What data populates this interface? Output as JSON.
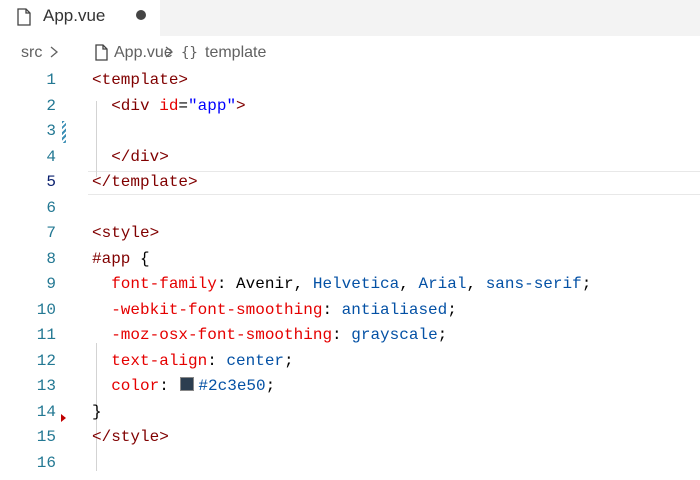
{
  "tab": {
    "filename": "App.vue",
    "dirty": true
  },
  "breadcrumb": {
    "folder": "src",
    "file": "App.vue",
    "symbol_glyph": "{}",
    "symbol": "template"
  },
  "editor": {
    "active_line": 5,
    "lines": [
      {
        "num": "1",
        "tokens": [
          [
            "t-tag",
            "<template>"
          ]
        ]
      },
      {
        "num": "2",
        "tokens": [
          [
            "t-pun",
            "  "
          ],
          [
            "t-tag",
            "<div"
          ],
          [
            "t-pun",
            " "
          ],
          [
            "t-attr",
            "id"
          ],
          [
            "t-pun",
            "="
          ],
          [
            "t-str",
            "\"app\""
          ],
          [
            "t-tag",
            ">"
          ]
        ]
      },
      {
        "num": "3",
        "tokens": []
      },
      {
        "num": "4",
        "tokens": [
          [
            "t-pun",
            "  "
          ],
          [
            "t-tag",
            "</div>"
          ]
        ]
      },
      {
        "num": "5",
        "tokens": [
          [
            "t-tag",
            "</template>"
          ]
        ]
      },
      {
        "num": "6",
        "tokens": []
      },
      {
        "num": "7",
        "tokens": [
          [
            "t-tag",
            "<style>"
          ]
        ]
      },
      {
        "num": "8",
        "tokens": [
          [
            "t-sel",
            "#app"
          ],
          [
            "t-pun",
            " {"
          ]
        ]
      },
      {
        "num": "9",
        "tokens": [
          [
            "t-pun",
            "  "
          ],
          [
            "t-prop",
            "font-family"
          ],
          [
            "t-pun",
            ": Avenir, "
          ],
          [
            "t-val",
            "Helvetica"
          ],
          [
            "t-pun",
            ", "
          ],
          [
            "t-val",
            "Arial"
          ],
          [
            "t-pun",
            ", "
          ],
          [
            "t-val",
            "sans-serif"
          ],
          [
            "t-pun",
            ";"
          ]
        ]
      },
      {
        "num": "10",
        "tokens": [
          [
            "t-pun",
            "  "
          ],
          [
            "t-prop",
            "-webkit-font-smoothing"
          ],
          [
            "t-pun",
            ": "
          ],
          [
            "t-val",
            "antialiased"
          ],
          [
            "t-pun",
            ";"
          ]
        ]
      },
      {
        "num": "11",
        "tokens": [
          [
            "t-pun",
            "  "
          ],
          [
            "t-prop",
            "-moz-osx-font-smoothing"
          ],
          [
            "t-pun",
            ": "
          ],
          [
            "t-val",
            "grayscale"
          ],
          [
            "t-pun",
            ";"
          ]
        ]
      },
      {
        "num": "12",
        "tokens": [
          [
            "t-pun",
            "  "
          ],
          [
            "t-prop",
            "text-align"
          ],
          [
            "t-pun",
            ": "
          ],
          [
            "t-val",
            "center"
          ],
          [
            "t-pun",
            ";"
          ]
        ]
      },
      {
        "num": "13",
        "tokens": [
          [
            "t-pun",
            "  "
          ],
          [
            "t-prop",
            "color"
          ],
          [
            "t-pun",
            ": "
          ],
          [
            "swatch",
            "#2c3e50"
          ],
          [
            "t-val",
            "#2c3e50"
          ],
          [
            "t-pun",
            ";"
          ]
        ]
      },
      {
        "num": "14",
        "tokens": [
          [
            "t-pun",
            "}"
          ]
        ]
      },
      {
        "num": "15",
        "tokens": [
          [
            "t-tag",
            "</style>"
          ]
        ]
      },
      {
        "num": "16",
        "tokens": []
      }
    ]
  },
  "colors": {
    "line_number": "#237893",
    "tag": "#800000",
    "attribute": "#e50000",
    "value": "#0451a5",
    "string": "#0000ff"
  }
}
